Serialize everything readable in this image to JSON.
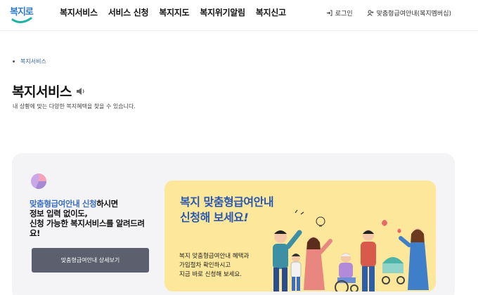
{
  "header": {
    "logo_text": "복지로",
    "nav": [
      "복지서비스",
      "서비스 신청",
      "복지지도",
      "복지위기알림",
      "복지신고"
    ],
    "login": "로그인",
    "membership": "맞춤형급여안내(복지멤버십)"
  },
  "breadcrumb": {
    "current": "복지서비스"
  },
  "page": {
    "title": "복지서비스",
    "description": "내 상황에 맞는 다양한 복지혜택을 찾을 수 있습니다."
  },
  "promo": {
    "highlight": "맞춤형급여안내 신청",
    "line1_rest": "하시면",
    "line2": "정보 입력 없이도,",
    "line3": "신청 가능한 복지서비스를 알려드려",
    "line4": "요!",
    "button": "맞춤형급여안내 상세보기"
  },
  "banner": {
    "title_line1": "복지 맞춤형급여안내",
    "title_line2": "신청해 보세요",
    "title_mark": "!",
    "body_line1": "복지 맞춤형급여안내 혜택과",
    "body_line2": "가입절차 확인하시고",
    "body_line3": "지금 바로 신청해 보세요."
  },
  "colors": {
    "brand_blue": "#2b77c9",
    "banner_bg": "#fde79a",
    "button_bg": "#5b5f6e",
    "highlight": "#3a6ec3"
  },
  "icons": [
    "logo-icon",
    "login-icon",
    "user-icon",
    "speaker-icon",
    "pie-chart-icon"
  ]
}
